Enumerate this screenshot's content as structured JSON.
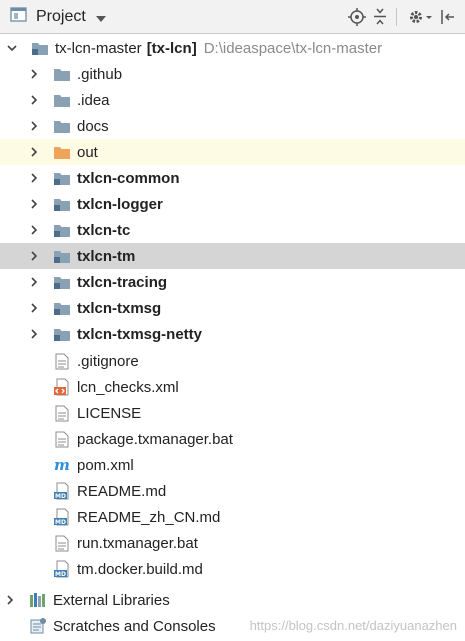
{
  "header": {
    "title": "Project"
  },
  "tree": {
    "root": {
      "name": "tx-lcn-master",
      "module": "[tx-lcn]",
      "path": "D:\\ideaspace\\tx-lcn-master"
    },
    "folders": [
      {
        "label": ".github"
      },
      {
        "label": ".idea"
      },
      {
        "label": "docs"
      },
      {
        "label": "out"
      }
    ],
    "modules": [
      {
        "label": "txlcn-common"
      },
      {
        "label": "txlcn-logger"
      },
      {
        "label": "txlcn-tc"
      },
      {
        "label": "txlcn-tm"
      },
      {
        "label": "txlcn-tracing"
      },
      {
        "label": "txlcn-txmsg"
      },
      {
        "label": "txlcn-txmsg-netty"
      }
    ],
    "files": [
      {
        "label": ".gitignore"
      },
      {
        "label": "lcn_checks.xml"
      },
      {
        "label": "LICENSE"
      },
      {
        "label": "package.txmanager.bat"
      },
      {
        "label": "pom.xml"
      },
      {
        "label": "README.md"
      },
      {
        "label": "README_zh_CN.md"
      },
      {
        "label": "run.txmanager.bat"
      },
      {
        "label": "tm.docker.build.md"
      }
    ],
    "external_libraries": "External Libraries",
    "scratches": "Scratches and Consoles"
  },
  "watermark": "https://blog.csdn.net/daziyuanazhen",
  "colors": {
    "selected_row": "#d5d5d5",
    "excluded_row": "#fdfbe3",
    "excluded_folder": "#f0a35a",
    "folder": "#8aa1b4",
    "markdown_badge": "#3e7fb5",
    "maven": "#2f8fd8"
  }
}
